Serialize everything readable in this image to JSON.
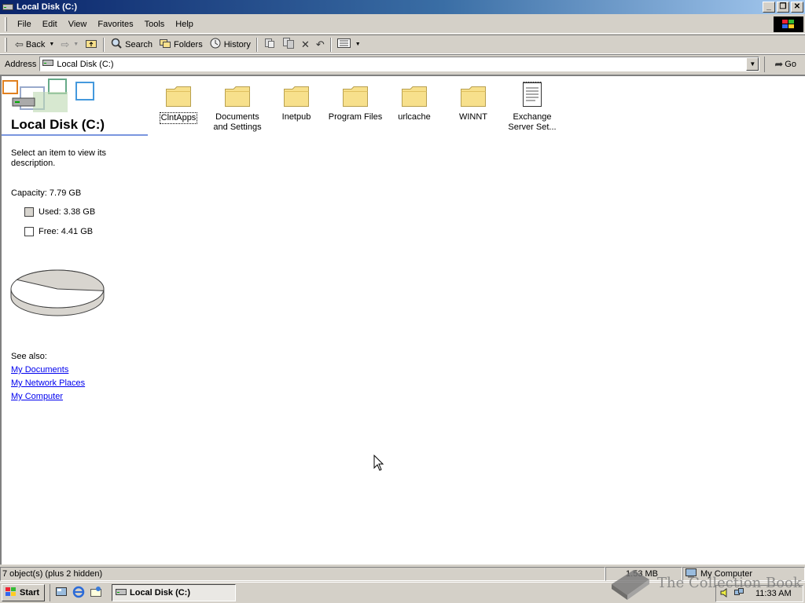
{
  "window": {
    "title": "Local Disk (C:)",
    "title_icon": "drive-icon",
    "controls": [
      "minimize",
      "restore",
      "close"
    ]
  },
  "menubar": {
    "items": [
      "File",
      "Edit",
      "View",
      "Favorites",
      "Tools",
      "Help"
    ]
  },
  "toolbar": {
    "back_label": "Back",
    "search_label": "Search",
    "folders_label": "Folders",
    "history_label": "History"
  },
  "address": {
    "label": "Address",
    "value": "Local Disk (C:)",
    "go_label": "Go"
  },
  "sidepanel": {
    "title": "Local Disk (C:)",
    "description": "Select an item to view its description.",
    "capacity": "Capacity: 7.79 GB",
    "used": "Used: 3.38 GB",
    "free": "Free: 4.41 GB",
    "used_gb": 3.38,
    "free_gb": 4.41,
    "see_also": "See also:",
    "links": [
      "My Documents",
      "My Network Places",
      "My Computer"
    ]
  },
  "files": [
    {
      "name": "ClntApps",
      "type": "folder",
      "selected": true
    },
    {
      "name": "Documents and Settings",
      "type": "folder"
    },
    {
      "name": "Inetpub",
      "type": "folder"
    },
    {
      "name": "Program Files",
      "type": "folder"
    },
    {
      "name": "urlcache",
      "type": "folder"
    },
    {
      "name": "WINNT",
      "type": "folder"
    },
    {
      "name": "Exchange Server Set...",
      "type": "document"
    }
  ],
  "statusbar": {
    "objects": "7 object(s) (plus 2 hidden)",
    "size": "1.53 MB",
    "zone": "My Computer"
  },
  "taskbar": {
    "start_label": "Start",
    "task_label": "Local Disk (C:)",
    "clock": "11:33 AM"
  },
  "watermark": "The Collection Book",
  "colors": {
    "titlebar_start": "#0a246a",
    "titlebar_end": "#a6caf0",
    "chrome": "#d4d0c8",
    "link": "#0000ee",
    "folder": "#f7e08c"
  }
}
